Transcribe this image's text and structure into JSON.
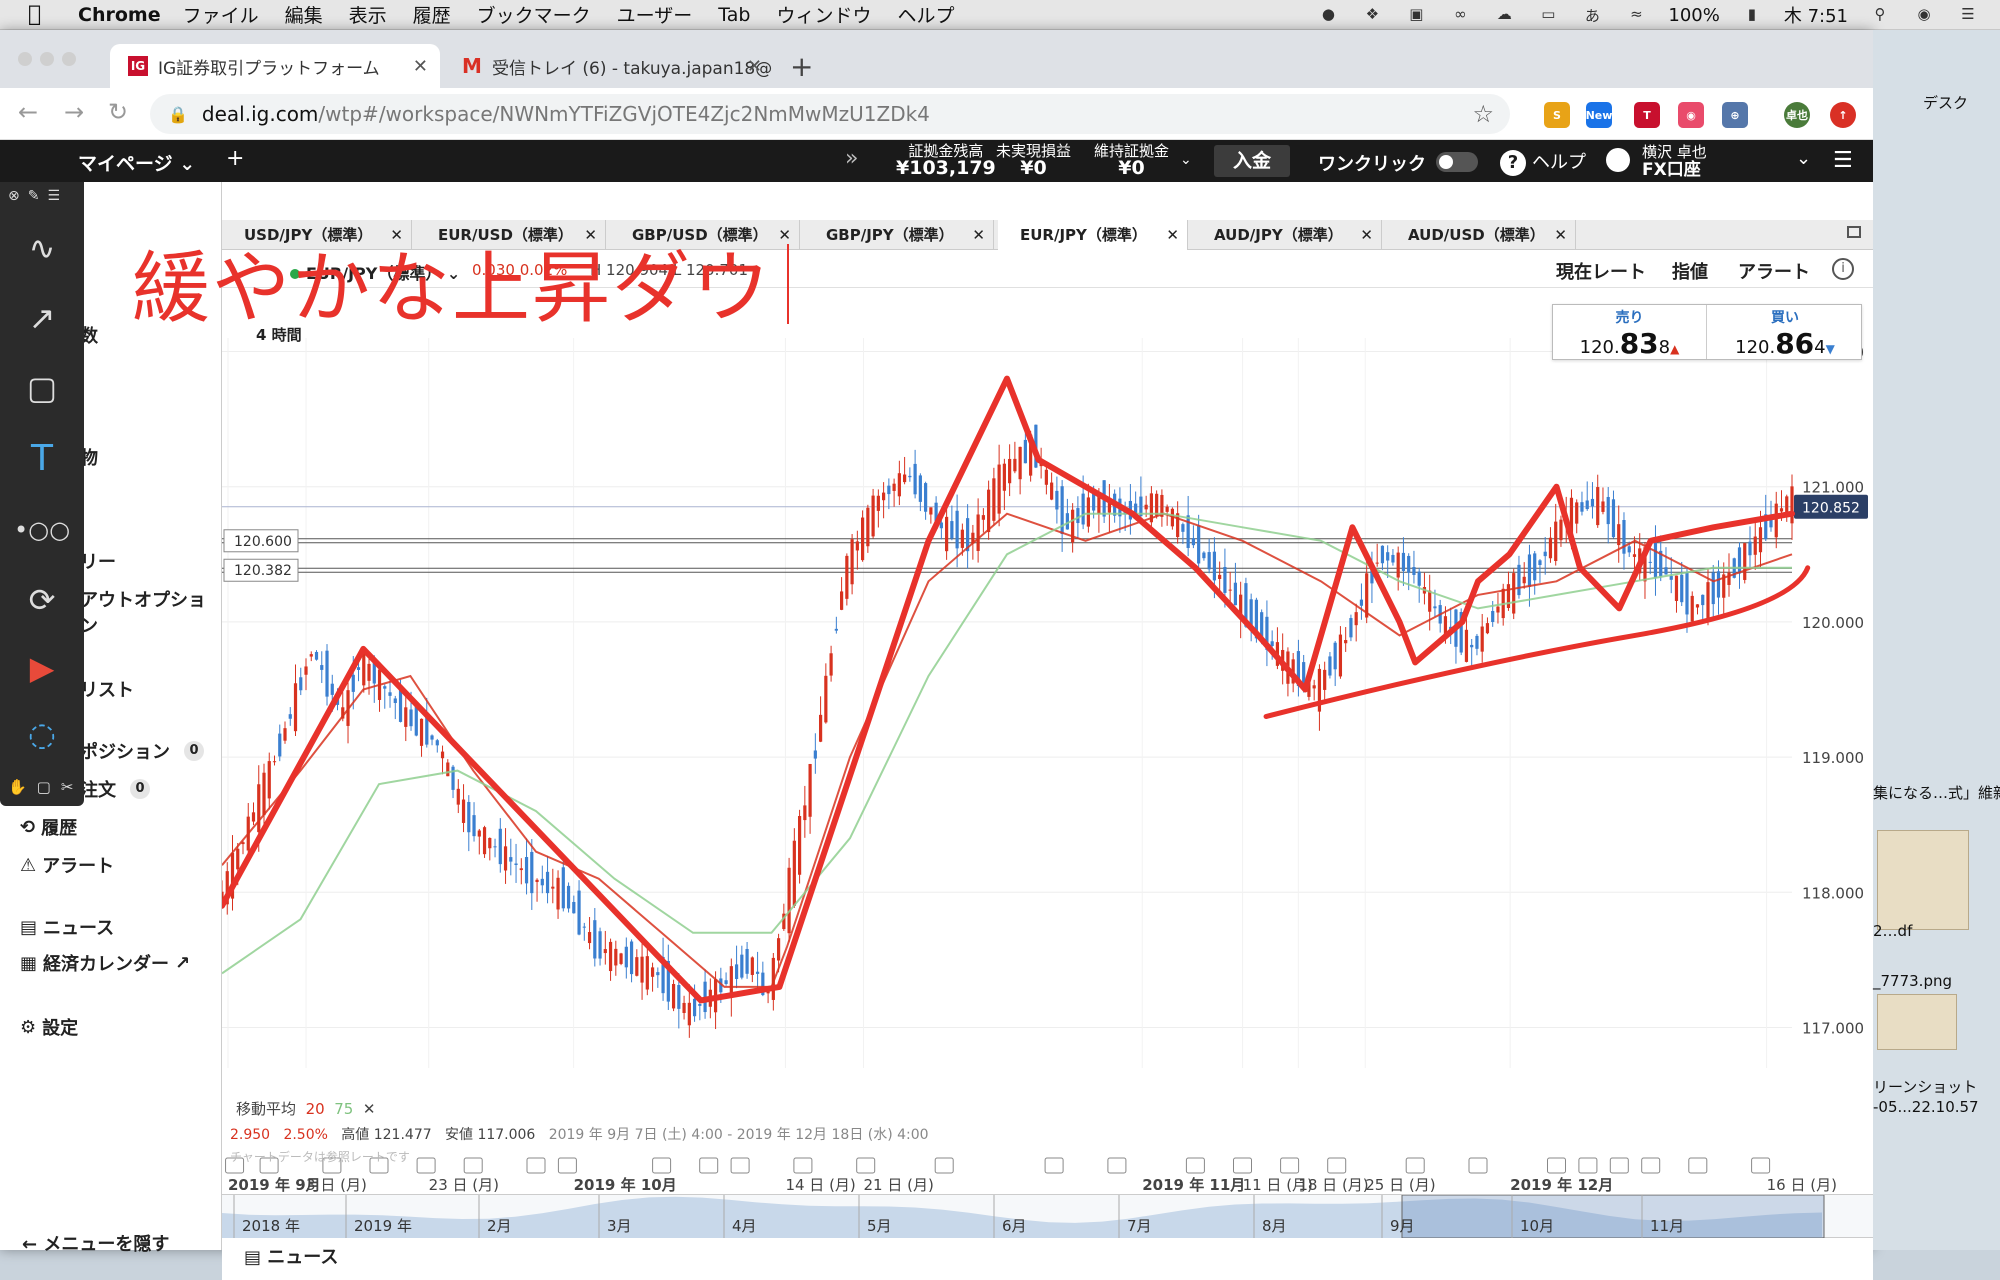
{
  "menubar": {
    "app": "Chrome",
    "items": [
      "ファイル",
      "編集",
      "表示",
      "履歴",
      "ブックマーク",
      "ユーザー",
      "Tab",
      "ウィンドウ",
      "ヘルプ"
    ],
    "battery": "100%",
    "ime": "あ",
    "clock": "木 7:51"
  },
  "browser": {
    "tabs": [
      {
        "favicon": "IG",
        "title": "IG証券取引プラットフォーム"
      },
      {
        "favicon": "M",
        "title": "受信トレイ (6) - takuya.japan18@"
      }
    ],
    "url_host": "deal.ig.com",
    "url_path": "/wtp#/workspace/NWNmYTFiZGVjOTE4Zjc2NmMwMzU1ZDk4",
    "ext_new_badge": "New",
    "profile_name": "卓也"
  },
  "platform": {
    "mypage": "マイページ",
    "account": [
      {
        "label": "証拠金残高",
        "value": "¥103,179"
      },
      {
        "label": "未実現損益",
        "value": "¥0"
      },
      {
        "label": "維持証拠金",
        "value": "¥0"
      }
    ],
    "deposit": "入金",
    "one_click": "ワンクリック",
    "help": "ヘルプ",
    "user_name": "横沢 卓也",
    "user_account": "FX口座"
  },
  "sidebar": {
    "items": [
      {
        "label": "数"
      },
      {
        "label": "物"
      },
      {
        "label": "リー"
      },
      {
        "label": "アウトオプション"
      },
      {
        "label": "リスト"
      },
      {
        "label": "ポジション",
        "badge": "0"
      },
      {
        "label": "注文",
        "badge": "0"
      },
      {
        "label": "履歴"
      },
      {
        "label": "アラート"
      },
      {
        "label": "ニュース"
      },
      {
        "label": "経済カレンダー"
      },
      {
        "label": "設定"
      }
    ],
    "hide_menu": "← メニューを隠す"
  },
  "instrument_tabs": [
    "USD/JPY（標準）",
    "EUR/USD（標準）",
    "GBP/USD（標準）",
    "GBP/JPY（標準）",
    "EUR/JPY（標準）",
    "AUD/JPY（標準）",
    "AUD/USD（標準）"
  ],
  "chart_header": {
    "instrument": "EUR/JPY（標準）",
    "change": "0.030  0.02%",
    "high_low": "H 120.904  L 120.701",
    "buttons": [
      "現在レート",
      "指値",
      "アラート"
    ]
  },
  "timeframe": "4 時間",
  "quote": {
    "sell_label": "売り",
    "sell_prefix": "120.",
    "sell_big": "83",
    "sell_small": "8",
    "buy_label": "買い",
    "buy_prefix": "120.",
    "buy_big": "86",
    "buy_small": "4"
  },
  "annotation_text": "緩やかな上昇ダウ",
  "indicator": {
    "label": "移動平均",
    "p1": "20",
    "p2": "75"
  },
  "stats": {
    "chg": "2.950",
    "pct": "2.50%",
    "high": "高値 121.477",
    "low": "安値 117.006",
    "range": "2019 年 9月 7日 (土) 4:00 - 2019 年 12月 18日 (水) 4:00",
    "faint": "チャートデータは参照レートです"
  },
  "news_bar": "ニュース",
  "desktop": {
    "label1": "デスク",
    "label2": "集になる…式」維新",
    "label3": "2…df",
    "label4": "_7773.png",
    "label5": "リーンショット",
    "label6": "-05...22.10.57"
  },
  "colors": {
    "up_candle": "#d8321f",
    "down_candle": "#3a7fd0",
    "ma20": "#d8321f",
    "ma75": "#8fcf8f",
    "annotation": "#e8322b"
  },
  "chart_data": {
    "type": "line",
    "title": "EUR/JPY（標準） 4 時間",
    "ylim": [
      116.7,
      122.1
    ],
    "y_ticks": [
      117.0,
      118.0,
      119.0,
      120.0,
      121.0,
      122.0
    ],
    "y_tick_labels": [
      "117.000",
      "118.000",
      "119.000",
      "120.000",
      "121.000",
      "122.000"
    ],
    "x_tick_labels": [
      "2019 年 9月",
      "3 日 (月)",
      "23 日 (月)",
      "2019 年 10月",
      "14 日 (月)",
      "21 日 (月)",
      "2019 年 11月",
      "11 日 (月)",
      "18 日 (月)",
      "25 日 (月)",
      "2019 年 12月",
      "16 日 (月)"
    ],
    "current_price": "120.852",
    "price_lines": [
      {
        "label": "120.600",
        "value": 120.6
      },
      {
        "label": "120.382",
        "value": 120.382
      }
    ],
    "series": [
      {
        "name": "20",
        "x": [
          0,
          5,
          9,
          12,
          16,
          20,
          24,
          28,
          32,
          35,
          36,
          40,
          45,
          50,
          55,
          60,
          65,
          70,
          75,
          80,
          85,
          90,
          95,
          100
        ],
        "values": [
          118.2,
          118.9,
          119.5,
          119.6,
          118.9,
          118.3,
          118.1,
          117.7,
          117.3,
          117.3,
          117.6,
          119.0,
          120.3,
          120.8,
          120.6,
          120.8,
          120.6,
          120.3,
          119.9,
          120.2,
          120.3,
          120.6,
          120.3,
          120.5
        ]
      },
      {
        "name": "75",
        "x": [
          0,
          5,
          10,
          15,
          20,
          25,
          30,
          35,
          40,
          45,
          50,
          55,
          60,
          65,
          70,
          75,
          80,
          85,
          90,
          95,
          100
        ],
        "values": [
          117.4,
          117.8,
          118.8,
          118.9,
          118.6,
          118.1,
          117.7,
          117.7,
          118.4,
          119.6,
          120.5,
          120.8,
          120.8,
          120.7,
          120.6,
          120.3,
          120.1,
          120.2,
          120.3,
          120.4,
          120.4
        ]
      }
    ],
    "price_x": [
      0,
      2,
      4,
      6,
      8,
      9,
      10,
      12,
      14,
      16,
      18,
      20,
      22,
      24,
      26,
      28,
      30,
      32,
      34,
      35,
      36,
      38,
      40,
      42,
      44,
      46,
      48,
      50,
      52,
      54,
      56,
      58,
      60,
      62,
      64,
      66,
      68,
      70,
      72,
      74,
      76,
      78,
      80,
      82,
      84,
      86,
      88,
      90,
      92,
      94,
      96,
      98,
      100
    ],
    "price_values": [
      117.9,
      118.5,
      119.1,
      119.8,
      119.3,
      119.7,
      119.6,
      119.3,
      119.1,
      118.5,
      118.3,
      118.1,
      118.0,
      117.6,
      117.5,
      117.4,
      117.1,
      117.3,
      117.5,
      117.2,
      117.8,
      119.0,
      120.4,
      120.9,
      121.1,
      120.7,
      120.6,
      121.1,
      121.3,
      120.7,
      120.9,
      120.8,
      120.9,
      120.6,
      120.3,
      120.0,
      119.7,
      119.5,
      119.9,
      120.5,
      120.4,
      120.0,
      119.8,
      120.2,
      120.4,
      120.8,
      120.9,
      120.5,
      120.4,
      120.1,
      120.3,
      120.6,
      120.9
    ]
  }
}
